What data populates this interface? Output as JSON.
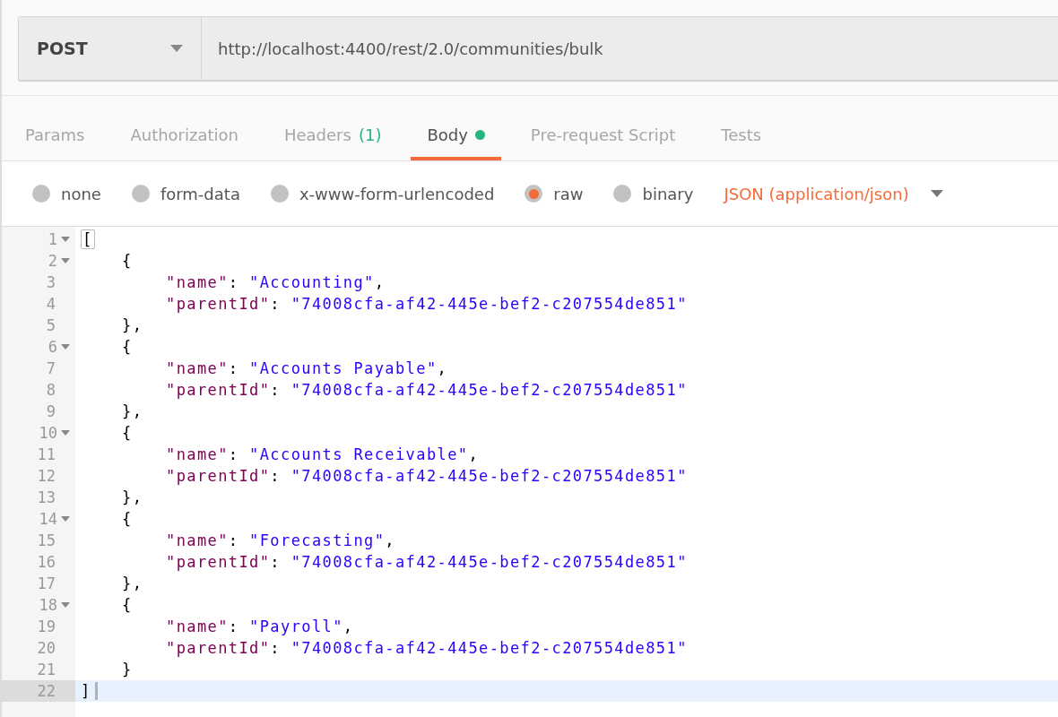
{
  "request": {
    "method": "POST",
    "url": "http://localhost:4400/rest/2.0/communities/bulk"
  },
  "tabs": [
    {
      "label": "Params",
      "selected": false
    },
    {
      "label": "Authorization",
      "selected": false
    },
    {
      "label": "Headers",
      "badge": "(1)",
      "selected": false
    },
    {
      "label": "Body",
      "dot": true,
      "selected": true
    },
    {
      "label": "Pre-request Script",
      "selected": false
    },
    {
      "label": "Tests",
      "selected": false
    }
  ],
  "body_types": [
    {
      "label": "none",
      "selected": false
    },
    {
      "label": "form-data",
      "selected": false
    },
    {
      "label": "x-www-form-urlencoded",
      "selected": false
    },
    {
      "label": "raw",
      "selected": true
    },
    {
      "label": "binary",
      "selected": false
    }
  ],
  "content_type": "JSON (application/json)",
  "editor": {
    "lines": [
      {
        "number": "1",
        "kind": "outer",
        "foldable": true,
        "active": false,
        "tokens": [
          {
            "kind": "bracket",
            "text": "["
          }
        ]
      },
      {
        "number": "2",
        "kind": "object",
        "foldable": true,
        "active": false,
        "tokens": [
          {
            "kind": "punct",
            "text": "{"
          }
        ]
      },
      {
        "number": "3",
        "kind": "field",
        "foldable": false,
        "active": false,
        "tokens": [
          {
            "kind": "key",
            "text": "\"name\""
          },
          {
            "kind": "punct",
            "text": ": "
          },
          {
            "kind": "string",
            "text": "\"Accounting\""
          },
          {
            "kind": "punct",
            "text": ","
          }
        ]
      },
      {
        "number": "4",
        "kind": "field",
        "foldable": false,
        "active": false,
        "tokens": [
          {
            "kind": "key",
            "text": "\"parentId\""
          },
          {
            "kind": "punct",
            "text": ": "
          },
          {
            "kind": "string",
            "text": "\"74008cfa-af42-445e-bef2-c207554de851\""
          }
        ]
      },
      {
        "number": "5",
        "kind": "object",
        "foldable": false,
        "active": false,
        "tokens": [
          {
            "kind": "punct",
            "text": "},"
          }
        ]
      },
      {
        "number": "6",
        "kind": "object",
        "foldable": true,
        "active": false,
        "tokens": [
          {
            "kind": "punct",
            "text": "{"
          }
        ]
      },
      {
        "number": "7",
        "kind": "field",
        "foldable": false,
        "active": false,
        "tokens": [
          {
            "kind": "key",
            "text": "\"name\""
          },
          {
            "kind": "punct",
            "text": ": "
          },
          {
            "kind": "string",
            "text": "\"Accounts Payable\""
          },
          {
            "kind": "punct",
            "text": ","
          }
        ]
      },
      {
        "number": "8",
        "kind": "field",
        "foldable": false,
        "active": false,
        "tokens": [
          {
            "kind": "key",
            "text": "\"parentId\""
          },
          {
            "kind": "punct",
            "text": ": "
          },
          {
            "kind": "string",
            "text": "\"74008cfa-af42-445e-bef2-c207554de851\""
          }
        ]
      },
      {
        "number": "9",
        "kind": "object",
        "foldable": false,
        "active": false,
        "tokens": [
          {
            "kind": "punct",
            "text": "},"
          }
        ]
      },
      {
        "number": "10",
        "kind": "object",
        "foldable": true,
        "active": false,
        "tokens": [
          {
            "kind": "punct",
            "text": "{"
          }
        ]
      },
      {
        "number": "11",
        "kind": "field",
        "foldable": false,
        "active": false,
        "tokens": [
          {
            "kind": "key",
            "text": "\"name\""
          },
          {
            "kind": "punct",
            "text": ": "
          },
          {
            "kind": "string",
            "text": "\"Accounts Receivable\""
          },
          {
            "kind": "punct",
            "text": ","
          }
        ]
      },
      {
        "number": "12",
        "kind": "field",
        "foldable": false,
        "active": false,
        "tokens": [
          {
            "kind": "key",
            "text": "\"parentId\""
          },
          {
            "kind": "punct",
            "text": ": "
          },
          {
            "kind": "string",
            "text": "\"74008cfa-af42-445e-bef2-c207554de851\""
          }
        ]
      },
      {
        "number": "13",
        "kind": "object",
        "foldable": false,
        "active": false,
        "tokens": [
          {
            "kind": "punct",
            "text": "},"
          }
        ]
      },
      {
        "number": "14",
        "kind": "object",
        "foldable": true,
        "active": false,
        "tokens": [
          {
            "kind": "punct",
            "text": "{"
          }
        ]
      },
      {
        "number": "15",
        "kind": "field",
        "foldable": false,
        "active": false,
        "tokens": [
          {
            "kind": "key",
            "text": "\"name\""
          },
          {
            "kind": "punct",
            "text": ": "
          },
          {
            "kind": "string",
            "text": "\"Forecasting\""
          },
          {
            "kind": "punct",
            "text": ","
          }
        ]
      },
      {
        "number": "16",
        "kind": "field",
        "foldable": false,
        "active": false,
        "tokens": [
          {
            "kind": "key",
            "text": "\"parentId\""
          },
          {
            "kind": "punct",
            "text": ": "
          },
          {
            "kind": "string",
            "text": "\"74008cfa-af42-445e-bef2-c207554de851\""
          }
        ]
      },
      {
        "number": "17",
        "kind": "object",
        "foldable": false,
        "active": false,
        "tokens": [
          {
            "kind": "punct",
            "text": "},"
          }
        ]
      },
      {
        "number": "18",
        "kind": "object",
        "foldable": true,
        "active": false,
        "tokens": [
          {
            "kind": "punct",
            "text": "{"
          }
        ]
      },
      {
        "number": "19",
        "kind": "field",
        "foldable": false,
        "active": false,
        "tokens": [
          {
            "kind": "key",
            "text": "\"name\""
          },
          {
            "kind": "punct",
            "text": ": "
          },
          {
            "kind": "string",
            "text": "\"Payroll\""
          },
          {
            "kind": "punct",
            "text": ","
          }
        ]
      },
      {
        "number": "20",
        "kind": "field",
        "foldable": false,
        "active": false,
        "tokens": [
          {
            "kind": "key",
            "text": "\"parentId\""
          },
          {
            "kind": "punct",
            "text": ": "
          },
          {
            "kind": "string",
            "text": "\"74008cfa-af42-445e-bef2-c207554de851\""
          }
        ]
      },
      {
        "number": "21",
        "kind": "object",
        "foldable": false,
        "active": false,
        "tokens": [
          {
            "kind": "punct",
            "text": "}"
          }
        ]
      },
      {
        "number": "22",
        "kind": "outer",
        "foldable": false,
        "active": true,
        "tokens": [
          {
            "kind": "punct",
            "text": "]"
          }
        ]
      }
    ]
  }
}
